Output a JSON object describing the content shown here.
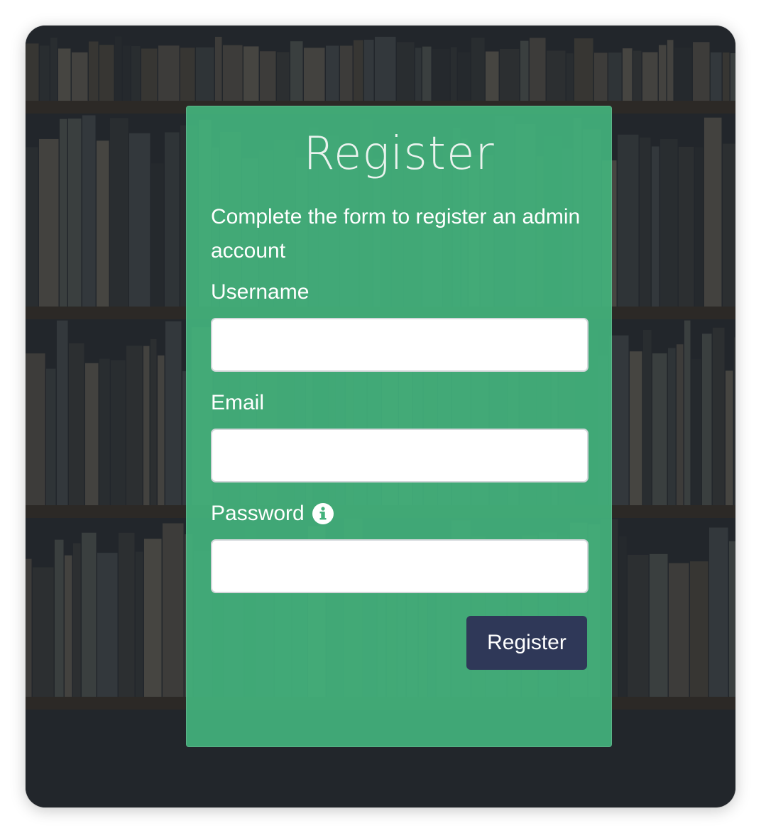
{
  "form": {
    "title": "Register",
    "subtitle": "Complete the form to register an admin account",
    "fields": [
      {
        "label": "Username",
        "value": "",
        "placeholder": ""
      },
      {
        "label": "Email",
        "value": "",
        "placeholder": ""
      },
      {
        "label": "Password",
        "value": "",
        "placeholder": ""
      }
    ],
    "password_info_icon": "info-circle-icon",
    "submit_label": "Register"
  },
  "colors": {
    "card_background": "#43b27c",
    "button_background": "#2f3858",
    "page_background": "#2a2f33"
  }
}
